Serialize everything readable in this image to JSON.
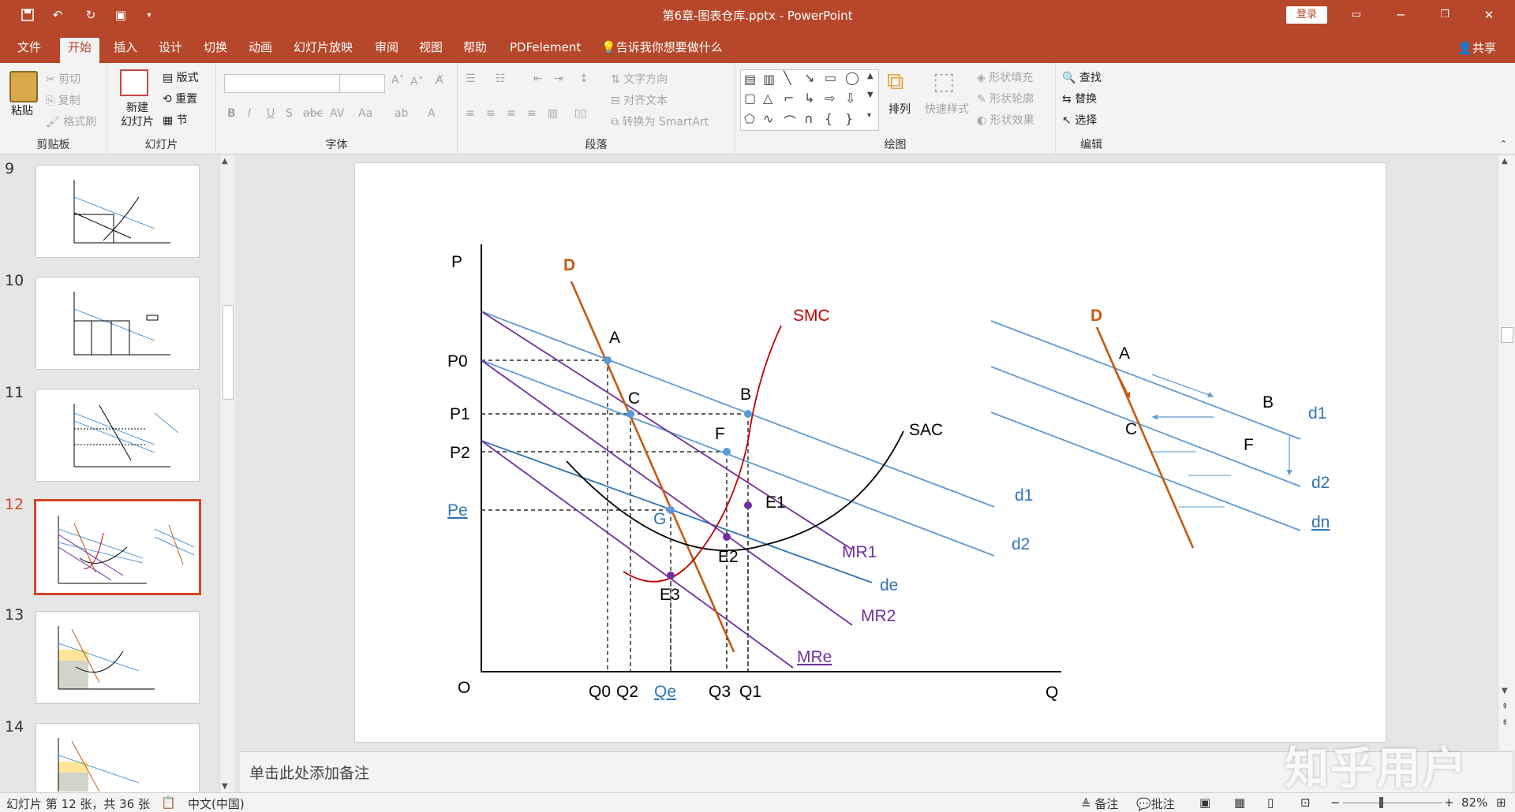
{
  "window": {
    "title": "第6章-图表仓库.pptx - PowerPoint",
    "login": "登录"
  },
  "tabs": [
    {
      "label": "文件"
    },
    {
      "label": "开始"
    },
    {
      "label": "插入"
    },
    {
      "label": "设计"
    },
    {
      "label": "切换"
    },
    {
      "label": "动画"
    },
    {
      "label": "幻灯片放映"
    },
    {
      "label": "审阅"
    },
    {
      "label": "视图"
    },
    {
      "label": "帮助"
    },
    {
      "label": "PDFelement"
    },
    {
      "label": "告诉我你想要做什么"
    }
  ],
  "share": "共享",
  "ribbon": {
    "clipboard": {
      "group": "剪贴板",
      "paste": "粘贴",
      "cut": "剪切",
      "copy": "复制",
      "format_painter": "格式刷"
    },
    "slides": {
      "group": "幻灯片",
      "new_slide": "新建\n幻灯片",
      "layout": "版式",
      "reset": "重置",
      "section": "节"
    },
    "font": {
      "group": "字体"
    },
    "paragraph": {
      "group": "段落",
      "text_direction": "文字方向",
      "align_text": "对齐文本",
      "smartart": "转换为 SmartArt"
    },
    "drawing": {
      "group": "绘图",
      "arrange": "排列",
      "quick_styles": "快速样式",
      "shape_fill": "形状填充",
      "shape_outline": "形状轮廓",
      "shape_effects": "形状效果"
    },
    "editing": {
      "group": "编辑",
      "find": "查找",
      "replace": "替换",
      "select": "选择"
    }
  },
  "thumbnails": [
    {
      "num": "9"
    },
    {
      "num": "10"
    },
    {
      "num": "11"
    },
    {
      "num": "12"
    },
    {
      "num": "13"
    },
    {
      "num": "14"
    }
  ],
  "notes_placeholder": "单击此处添加备注",
  "status": {
    "slide_info": "幻灯片 第 12 张，共 36 张",
    "language": "中文(中国)",
    "notes": "备注",
    "comments": "批注",
    "zoom": "82%"
  },
  "watermark": "知乎用户",
  "slide": {
    "axis": {
      "p": "P",
      "q": "Q",
      "origin": "O"
    },
    "price_labels": {
      "p0": "P0",
      "p1": "P1",
      "p2": "P2",
      "pe": "Pe"
    },
    "qty_labels": {
      "q0": "Q0",
      "q2": "Q2",
      "qe": "Qe",
      "q3": "Q3",
      "q1": "Q1"
    },
    "curve_labels": {
      "d": "D",
      "smc": "SMC",
      "sac": "SAC",
      "d1": "d1",
      "d2": "d2",
      "de": "de",
      "mr1": "MR1",
      "mr2": "MR2",
      "mre": "MRe"
    },
    "point_labels": {
      "a": "A",
      "b": "B",
      "c": "C",
      "f": "F",
      "g": "G",
      "e1": "E1",
      "e2": "E2",
      "e3": "E3"
    },
    "right_diagram": {
      "d": "D",
      "a": "A",
      "b": "B",
      "c": "C",
      "f": "F",
      "d1": "d1",
      "d2": "d2",
      "dn": "dn"
    },
    "colors": {
      "d": "#c55a11",
      "blue": "#5b9bd5",
      "purple": "#7030a0",
      "red": "#c00000",
      "de": "#2e75b6",
      "label_blue": "#2e75b6"
    }
  }
}
